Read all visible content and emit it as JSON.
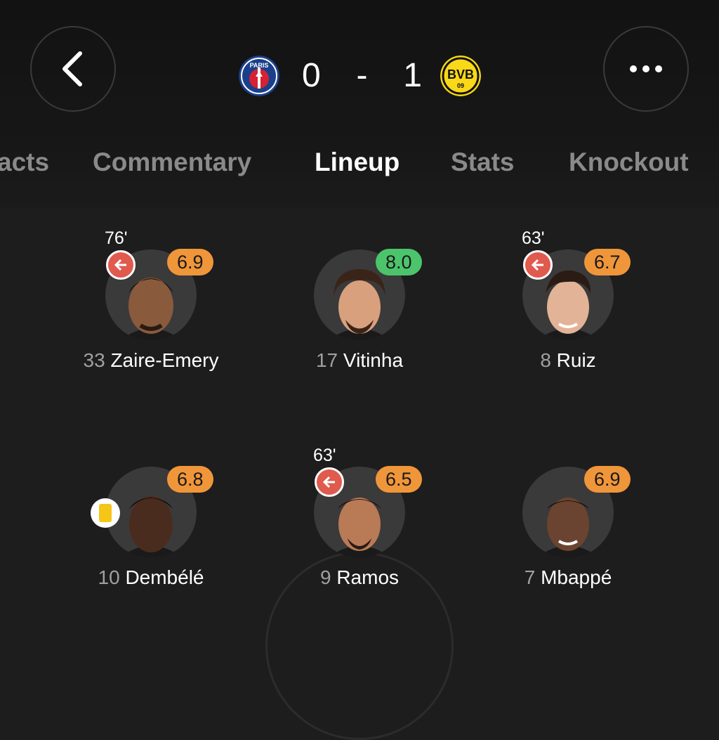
{
  "header": {
    "home_team_logo": "psg-logo",
    "away_team_logo": "bvb-logo",
    "home_logo_text": "PARIS",
    "away_logo_text": "BVB",
    "away_logo_sub": "09",
    "home_score": "0",
    "separator": "-",
    "away_score": "1",
    "back_icon": "chevron-left-icon",
    "more_icon": "more-dots-icon"
  },
  "tabs": [
    {
      "label": "Facts",
      "visible_text": "acts",
      "active": false
    },
    {
      "label": "Commentary",
      "active": false
    },
    {
      "label": "Lineup",
      "active": true
    },
    {
      "label": "Stats",
      "active": false
    },
    {
      "label": "Knockout",
      "active": false
    }
  ],
  "players": [
    {
      "number": "33",
      "name": "Zaire-Emery",
      "rating": "6.9",
      "rating_color": "#f0963a",
      "sub_time": "76'",
      "subbed": true
    },
    {
      "number": "17",
      "name": "Vitinha",
      "rating": "8.0",
      "rating_color": "#4cc46b"
    },
    {
      "number": "8",
      "name": "Ruiz",
      "rating": "6.7",
      "rating_color": "#f0963a",
      "sub_time": "63'",
      "subbed": true
    },
    {
      "number": "10",
      "name": "Dembélé",
      "rating": "6.8",
      "rating_color": "#f0963a",
      "yellow_card": true
    },
    {
      "number": "9",
      "name": "Ramos",
      "rating": "6.5",
      "rating_color": "#f0963a",
      "sub_time": "63'",
      "subbed": true
    },
    {
      "number": "7",
      "name": "Mbappé",
      "rating": "6.9",
      "rating_color": "#f0963a"
    }
  ],
  "colors": {
    "background": "#1d1d1d",
    "rating_orange": "#f0963a",
    "rating_green": "#4cc46b",
    "sub_red": "#e05a4e",
    "yellow_card": "#f5c518",
    "psg_blue": "#1b3f8b",
    "bvb_yellow": "#f8d818"
  }
}
